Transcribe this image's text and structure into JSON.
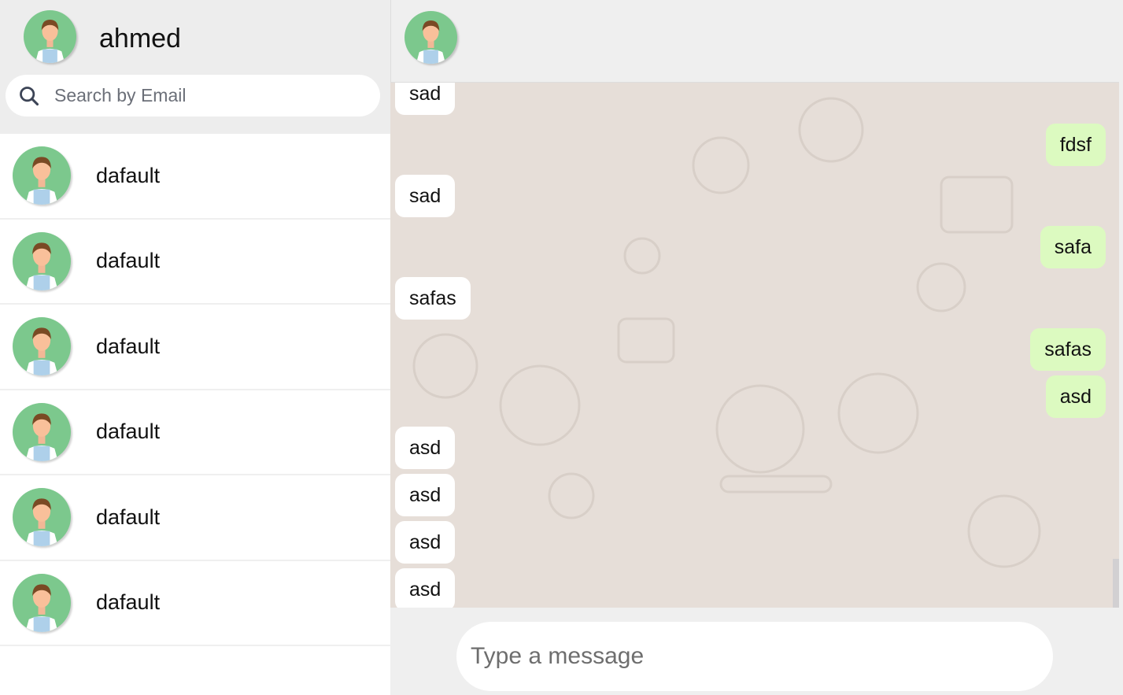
{
  "user": {
    "name": "ahmed",
    "avatar_icon": "user-avatar-icon"
  },
  "search": {
    "placeholder": "Search by Email",
    "icon": "search-icon"
  },
  "contacts": [
    {
      "name": "dafault"
    },
    {
      "name": "dafault"
    },
    {
      "name": "dafault"
    },
    {
      "name": "dafault"
    },
    {
      "name": "dafault"
    },
    {
      "name": "dafault"
    }
  ],
  "chat": {
    "messages": [
      {
        "text": "sad",
        "dir": "in"
      },
      {
        "text": "fdsf",
        "dir": "out"
      },
      {
        "text": "sad",
        "dir": "in"
      },
      {
        "text": "safa",
        "dir": "out"
      },
      {
        "text": "safas",
        "dir": "in"
      },
      {
        "text": "safas",
        "dir": "out"
      },
      {
        "text": "asd",
        "dir": "out"
      },
      {
        "text": "asd",
        "dir": "in"
      },
      {
        "text": "asd",
        "dir": "in"
      },
      {
        "text": "asd",
        "dir": "in"
      },
      {
        "text": "asd",
        "dir": "in"
      }
    ],
    "input_placeholder": "Type a message"
  },
  "colors": {
    "outgoing": "#dcfac0",
    "incoming": "#ffffff",
    "chat_bg": "#e6ded8",
    "avatar_bg": "#7cc88d"
  }
}
